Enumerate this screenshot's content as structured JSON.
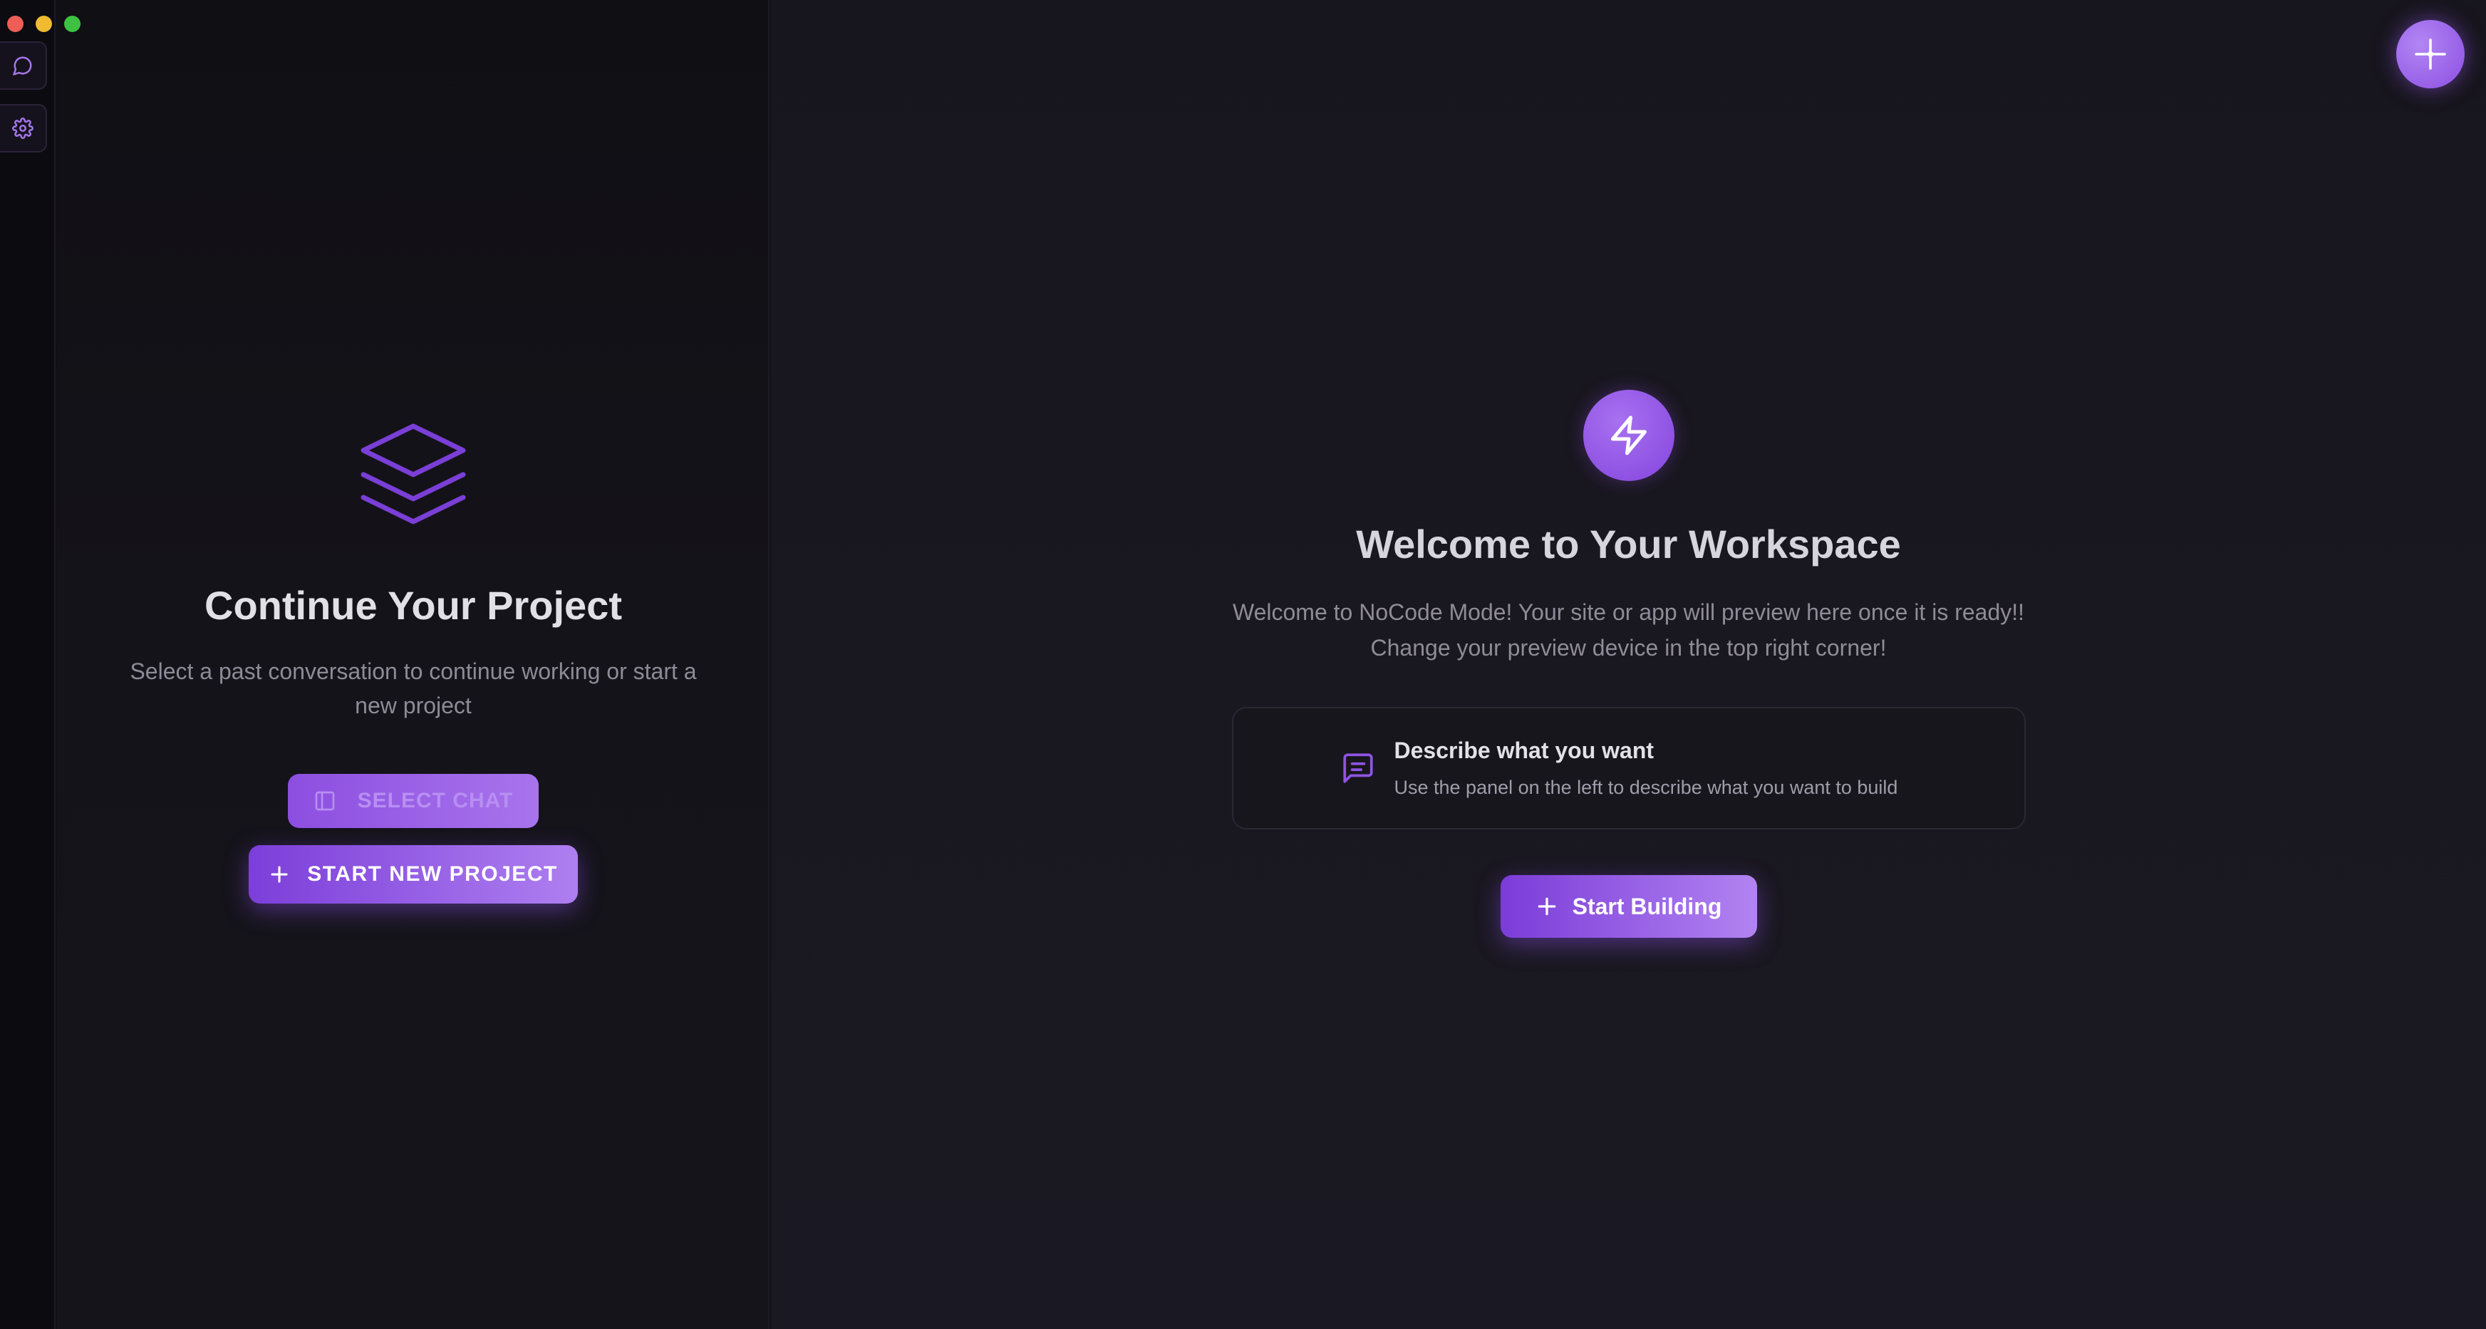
{
  "sidebar": {
    "icons": [
      "chat-bubble-icon",
      "gear-icon"
    ]
  },
  "left_panel": {
    "icon": "layers-stack-icon",
    "title": "Continue Your Project",
    "subtitle": "Select a past conversation to continue working or start a new project",
    "select_chat_label": "SELECT CHAT",
    "start_new_label": "START NEW PROJECT"
  },
  "workspace": {
    "icon": "lightning-bolt-icon",
    "title": "Welcome to Your Workspace",
    "subtitle_line1": "Welcome to NoCode Mode! Your site or app will preview here once it is ready!!",
    "subtitle_line2": "Change your preview device in the top right corner!",
    "card": {
      "icon": "message-square-icon",
      "title": "Describe what you want",
      "description": "Use the panel on the left to describe what you want to build"
    },
    "start_building_label": "Start Building",
    "fab_icon": "crosshair-icon"
  },
  "colors": {
    "accent": "#8c4fe2",
    "accent_light": "#b286f4",
    "background": "#111016"
  }
}
